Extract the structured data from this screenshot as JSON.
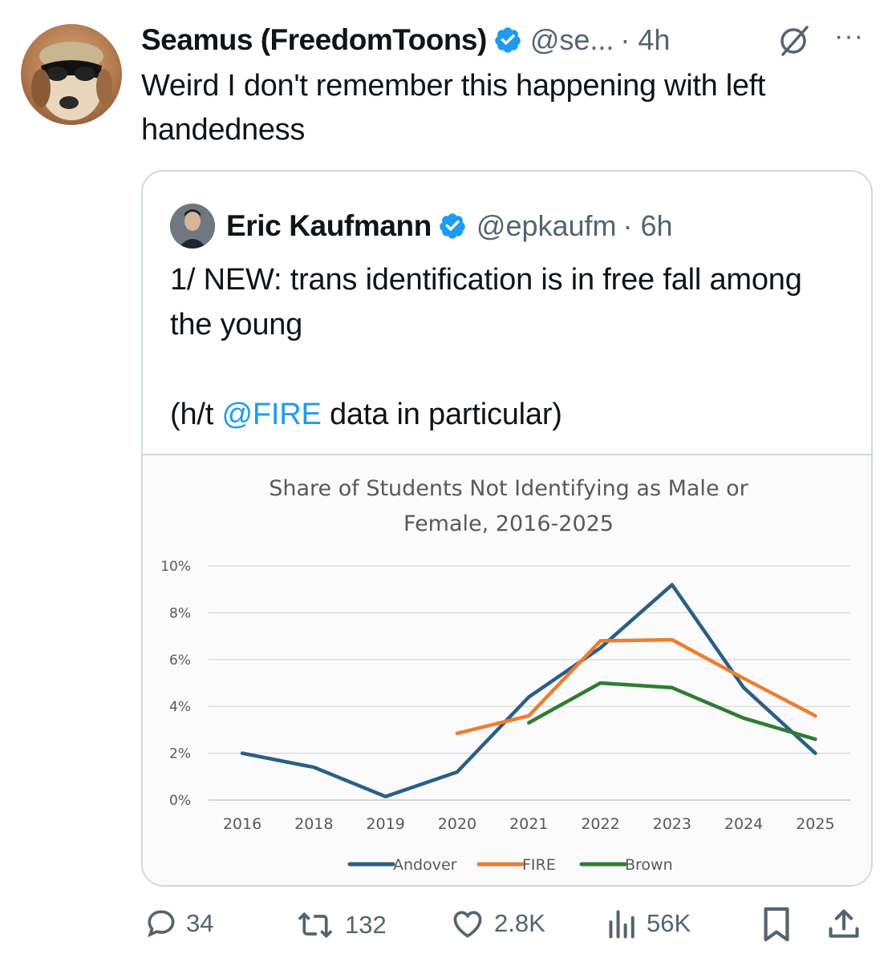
{
  "tweet": {
    "author_name": "Seamus (FreedomToons)",
    "handle": "@se...",
    "time": "· 4h",
    "text": "Weird I don't remember this happening with left handedness"
  },
  "quoted": {
    "author_name": "Eric Kaufmann",
    "handle": "@epkaufm",
    "time": "· 6h",
    "text_line1": "1/ NEW: trans identification is in free fall among the young",
    "ht_prefix": "(h/t ",
    "ht_mention": "@FIRE",
    "ht_suffix": " data in particular)"
  },
  "chart_data": {
    "type": "line",
    "title_line1": "Share of Students Not Identifying as Male or",
    "title_line2": "Female, 2016-2025",
    "categories": [
      "2016",
      "2018",
      "2019",
      "2020",
      "2021",
      "2022",
      "2023",
      "2024",
      "2025"
    ],
    "ylim": [
      0,
      10
    ],
    "yticks": [
      "0%",
      "2%",
      "4%",
      "6%",
      "8%",
      "10%"
    ],
    "series": [
      {
        "name": "Andover",
        "color": "#2a5f86",
        "values": [
          2.0,
          1.4,
          0.15,
          1.2,
          4.4,
          6.5,
          9.2,
          4.8,
          2.0
        ]
      },
      {
        "name": "FIRE",
        "color": "#ed7d31",
        "values": [
          null,
          null,
          null,
          2.85,
          3.6,
          6.8,
          6.85,
          5.2,
          3.6
        ]
      },
      {
        "name": "Brown",
        "color": "#2e7d32",
        "values": [
          null,
          null,
          null,
          null,
          3.3,
          5.0,
          4.8,
          3.5,
          2.6
        ]
      }
    ],
    "legend_position": "bottom",
    "grid": true
  },
  "actions": {
    "replies": "34",
    "reposts": "132",
    "likes": "2.8K",
    "views": "56K"
  },
  "colors": {
    "accent": "#1d9bf0",
    "muted": "#536471",
    "border": "#cfd9de"
  }
}
